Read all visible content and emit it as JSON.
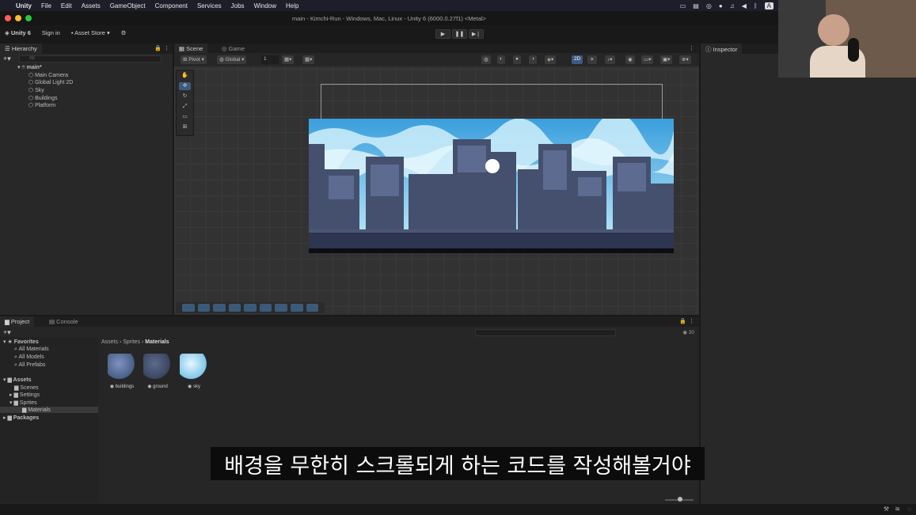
{
  "menubar": {
    "app_name": "Unity",
    "items": [
      "File",
      "Edit",
      "Assets",
      "GameObject",
      "Component",
      "Services",
      "Jobs",
      "Window",
      "Help"
    ]
  },
  "window": {
    "title": "main - Kimchi-Run - Windows, Mac, Linux - Unity 6 (6000.0.27f1) <Metal>"
  },
  "toolbar": {
    "account": "Unity 6",
    "sign_in": "Sign in",
    "asset_store": "Asset Store"
  },
  "hierarchy": {
    "tab": "Hierarchy",
    "search_placeholder": "All",
    "scene_name": "main*",
    "items": [
      "Main Camera",
      "Global Light 2D",
      "Sky",
      "Buildings",
      "Platform"
    ]
  },
  "scene_view": {
    "tabs": [
      "Scene",
      "Game"
    ],
    "pivot": "Pivot",
    "global": "Global",
    "grid_value": "1",
    "mode_2d": "2D"
  },
  "inspector": {
    "tab": "Inspector"
  },
  "project": {
    "tabs": [
      "Project",
      "Console"
    ],
    "favorites_label": "Favorites",
    "favorites": [
      "All Materials",
      "All Models",
      "All Prefabs"
    ],
    "assets_label": "Assets",
    "folders": [
      "Scenes",
      "Settings",
      "Sprites"
    ],
    "subfolder": "Materials",
    "packages_label": "Packages",
    "breadcrumb": [
      "Assets",
      "Sprites",
      "Materials"
    ],
    "asset_count": "30",
    "assets": [
      {
        "name": "buildings",
        "color": "#4a5f86"
      },
      {
        "name": "ground",
        "color": "#3a4660"
      },
      {
        "name": "sky",
        "color": "#7fc6ea"
      }
    ]
  },
  "subtitle": "배경을 무한히 스크롤되게 하는 코드를 작성해볼거야",
  "colors": {
    "sky_top": "#3a9fdc",
    "sky_bottom": "#aee0f5",
    "buildings": "#45506e",
    "ground": "#2e3550"
  }
}
